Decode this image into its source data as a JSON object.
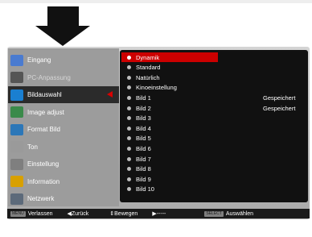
{
  "sidebar": {
    "items": [
      {
        "label": "Eingang",
        "icon": "input-icon"
      },
      {
        "label": "PC-Anpassung",
        "icon": "pc-adjust-icon"
      },
      {
        "label": "Bildauswahl",
        "icon": "image-select-icon"
      },
      {
        "label": "Image adjust",
        "icon": "image-adjust-icon"
      },
      {
        "label": "Format Bild",
        "icon": "screen-format-icon"
      },
      {
        "label": "Ton",
        "icon": "sound-icon"
      },
      {
        "label": "Einstellung",
        "icon": "setting-icon"
      },
      {
        "label": "Information",
        "icon": "information-icon"
      },
      {
        "label": "Netzwerk",
        "icon": "network-icon"
      }
    ],
    "active_index": 2,
    "disabled_index": 1
  },
  "menu": {
    "items": [
      {
        "label": "Dynamik",
        "value": ""
      },
      {
        "label": "Standard",
        "value": ""
      },
      {
        "label": "Natürlich",
        "value": ""
      },
      {
        "label": "Kinoeinstellung",
        "value": ""
      },
      {
        "label": "Bild 1",
        "value": "Gespeichert"
      },
      {
        "label": "Bild 2",
        "value": "Gespeichert"
      },
      {
        "label": "Bild 3",
        "value": ""
      },
      {
        "label": "Bild 4",
        "value": ""
      },
      {
        "label": "Bild 5",
        "value": ""
      },
      {
        "label": "Bild 6",
        "value": ""
      },
      {
        "label": "Bild 7",
        "value": ""
      },
      {
        "label": "Bild 8",
        "value": ""
      },
      {
        "label": "Bild 9",
        "value": ""
      },
      {
        "label": "Bild 10",
        "value": ""
      }
    ],
    "selected_index": 0
  },
  "footer": {
    "menu_key": "MENU",
    "exit": "Verlassen",
    "back": "◀Zurück",
    "move": "⇕Bewegen",
    "right": "▶-----",
    "select_key": "SELECT",
    "select": "Auswählen"
  },
  "colors": {
    "accent": "#cc0000",
    "panel": "#111111",
    "sidebar": "#9c9c9c"
  }
}
